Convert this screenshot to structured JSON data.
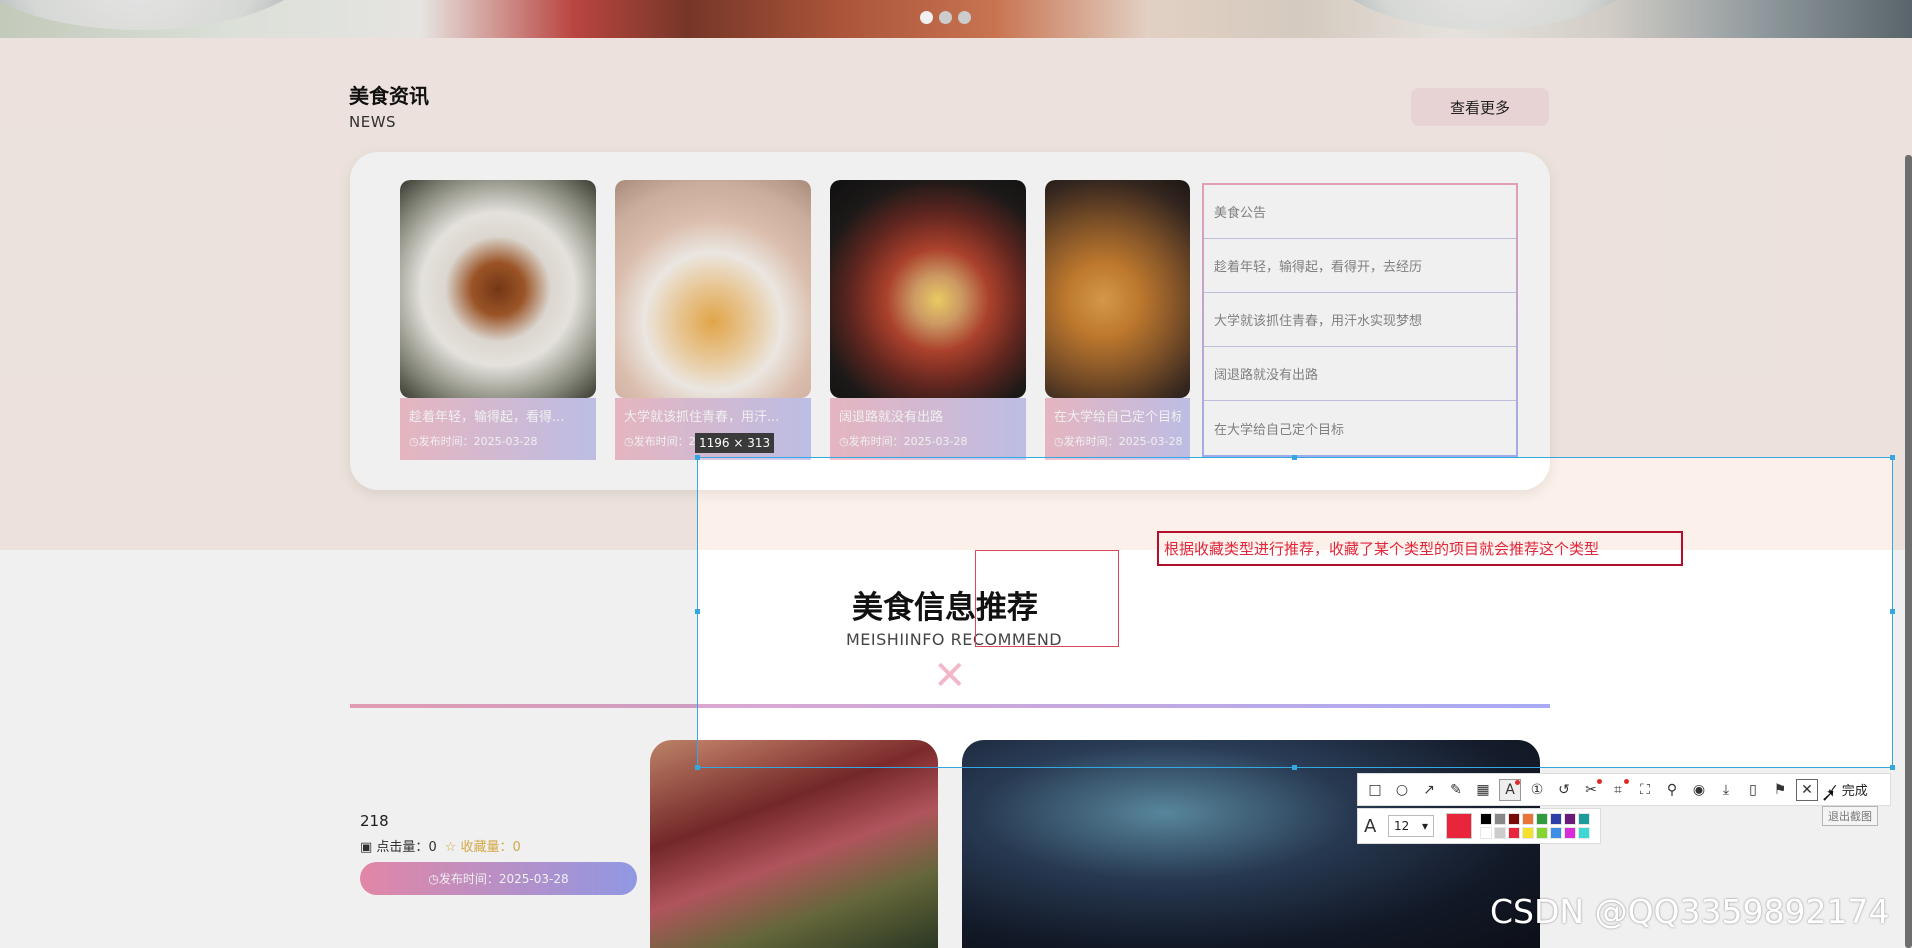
{
  "hero": {
    "dots": [
      true,
      false,
      false
    ]
  },
  "news": {
    "title": "美食资讯",
    "subtitle": "NEWS",
    "more_label": "查看更多",
    "cards": [
      {
        "title": "趁着年轻，输得起，看得...",
        "date": "◷发布时间：2025-03-28"
      },
      {
        "title": "大学就该抓住青春，用汗...",
        "date": "◷发布时间：2025-03-28"
      },
      {
        "title": "阔退路就没有出路",
        "date": "◷发布时间：2025-03-28"
      },
      {
        "title": "在大学给自己定个目标",
        "date": "◷发布时间：2025-03-28"
      }
    ],
    "notices": [
      "美食公告",
      "趁着年轻，输得起，看得开，去经历",
      "大学就该抓住青春，用汗水实现梦想",
      "阔退路就没有出路",
      "在大学给自己定个目标"
    ]
  },
  "recommend": {
    "title": "美食信息推荐",
    "subtitle": "MEISHIINFO RECOMMEND",
    "close_glyph": "✕",
    "meta_number": "218",
    "clicks_label": "点击量：",
    "clicks": "0",
    "favs_label": "收藏量：",
    "favs": "0",
    "publish": "◷发布时间：2025-03-28"
  },
  "capture": {
    "size_label": "1196 × 313",
    "annotation_text": "根据收藏类型进行推荐，收藏了某个类型的项目就会推荐这个类型",
    "font_size": "12",
    "current_color": "#e8253a",
    "palette_top": [
      "#000000",
      "#888888",
      "#7a0a0a",
      "#e8743b",
      "#2f9b3e",
      "#2f3fa8",
      "#6a1b7a",
      "#1b9b9b"
    ],
    "palette_bottom": [
      "#ffffff",
      "#cccccc",
      "#e8253a",
      "#f5e12c",
      "#86d431",
      "#3e8ee8",
      "#d92bd9",
      "#3fd6d6"
    ],
    "done_label": "完成",
    "close_tooltip": "退出截图",
    "tools": [
      "rect-icon",
      "ellipse-icon",
      "arrow-icon",
      "pen-icon",
      "mosaic-icon",
      "text-icon",
      "number-icon",
      "undo-icon",
      "cutout-icon",
      "translate-icon",
      "long-capture-icon",
      "pin-icon",
      "record-icon",
      "save-icon",
      "phone-icon",
      "bookmark-icon"
    ]
  },
  "watermark": "CSDN @QQ3359892174"
}
